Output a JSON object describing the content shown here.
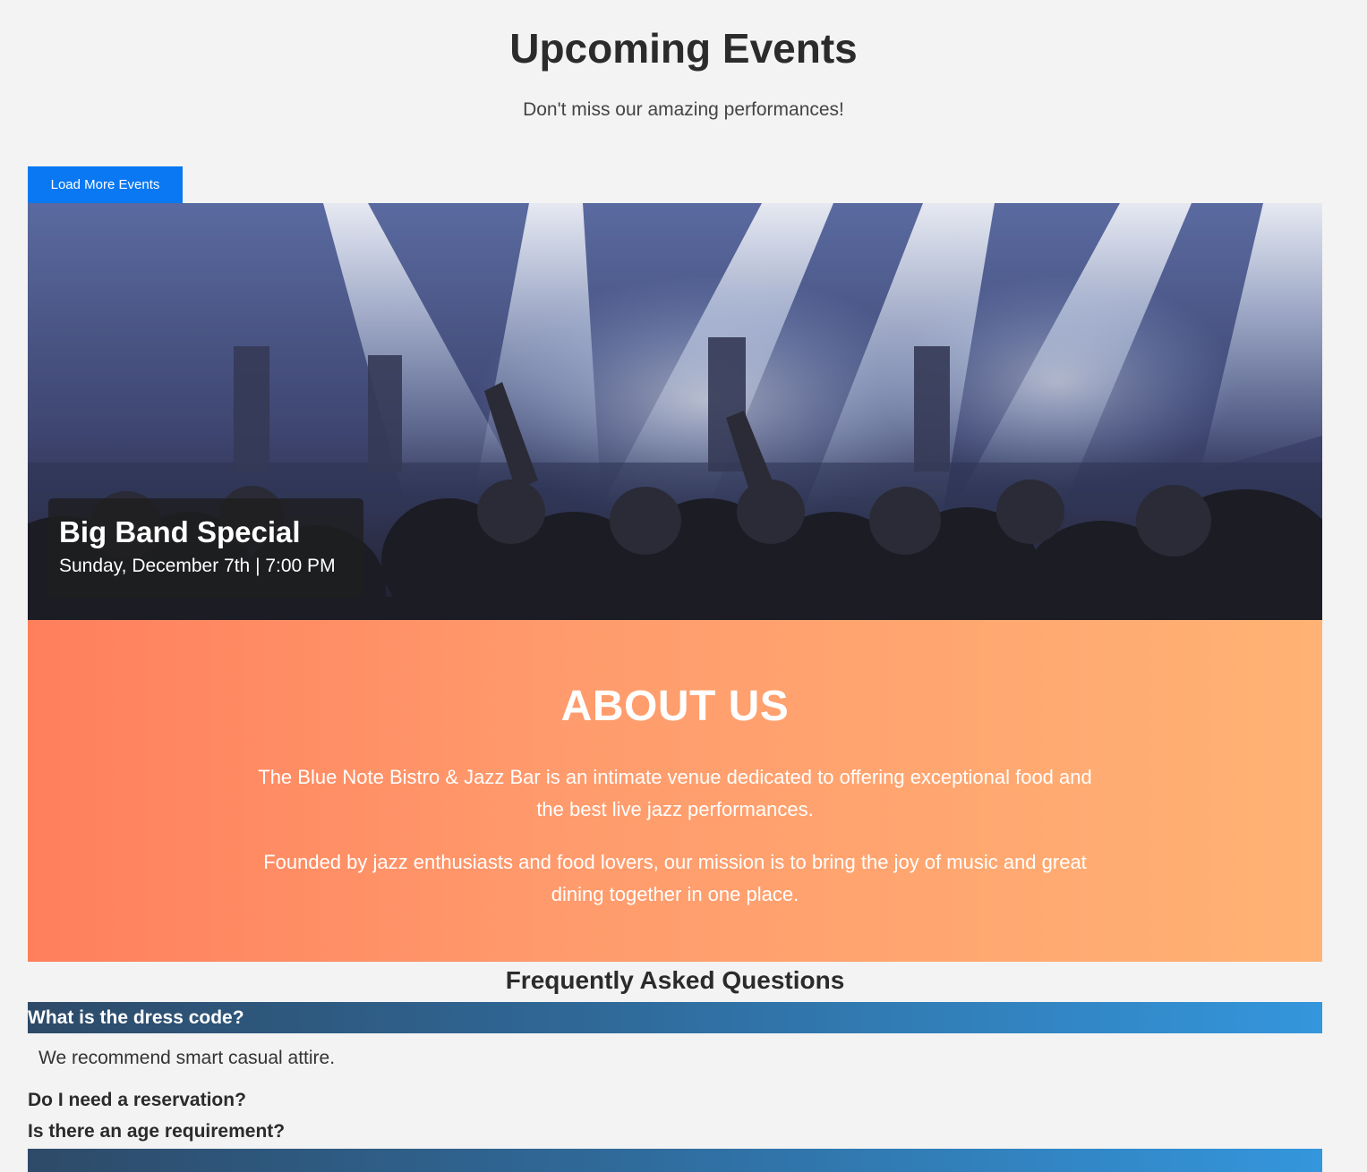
{
  "events": {
    "title": "Upcoming Events",
    "subtitle": "Don't miss our amazing performances!",
    "load_more_label": "Load More Events",
    "featured": {
      "name": "Big Band Special",
      "date": "Sunday, December 7th | 7:00 PM"
    }
  },
  "about": {
    "title": "ABOUT US",
    "paragraphs": [
      "The Blue Note Bistro & Jazz Bar is an intimate venue dedicated to offering exceptional food and the best live jazz performances.",
      "Founded by jazz enthusiasts and food lovers, our mission is to bring the joy of music and great dining together in one place."
    ]
  },
  "faq": {
    "heading": "Frequently Asked Questions",
    "items": [
      {
        "question": "What is the dress code?",
        "answer": "We recommend smart casual attire.",
        "expanded": true
      },
      {
        "question": "Do I need a reservation?",
        "expanded": false
      },
      {
        "question": "Is there an age requirement?",
        "expanded": false
      }
    ]
  },
  "colors": {
    "button": "#0a78f2",
    "about_gradient_start": "#ff7f5c",
    "about_gradient_end": "#ffb274",
    "faq_gradient_start": "#2e4a68",
    "faq_gradient_end": "#3496dc",
    "background": "#f3f3f3"
  }
}
